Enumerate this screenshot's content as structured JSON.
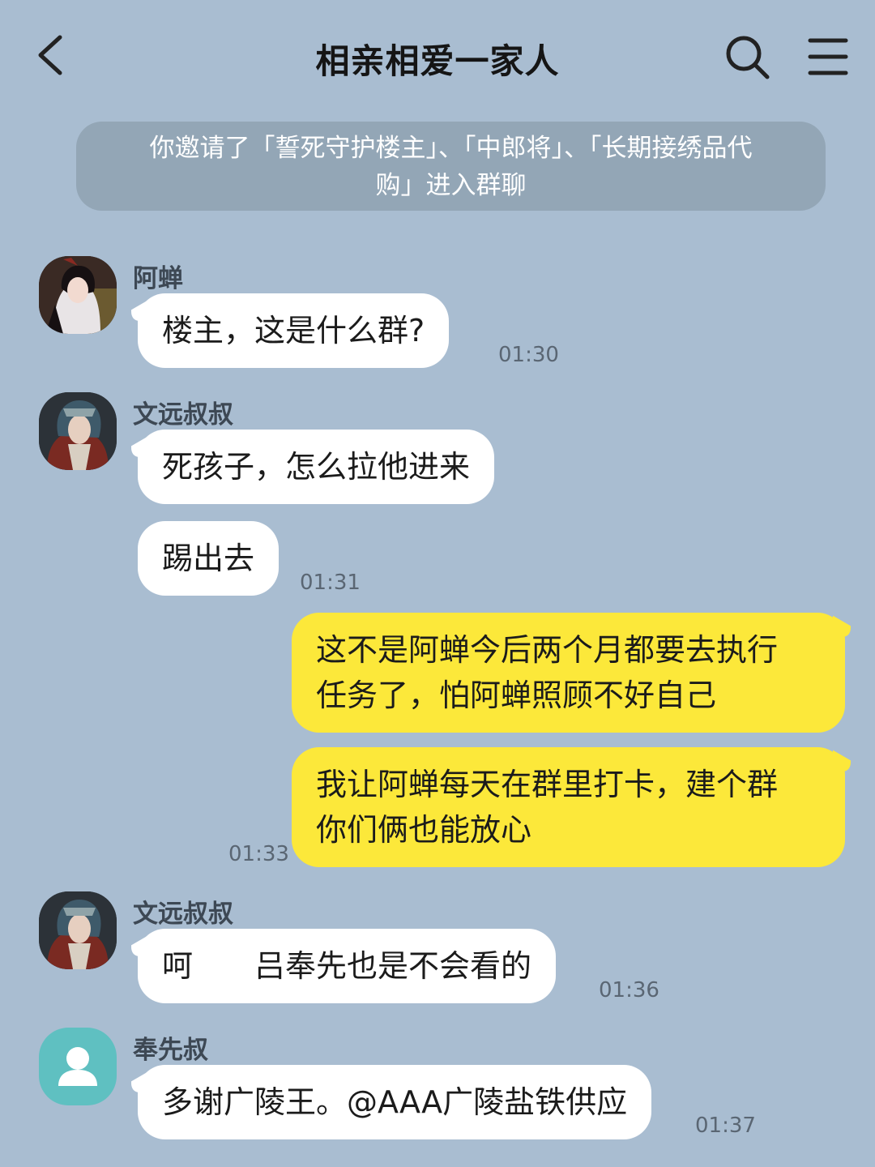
{
  "header": {
    "title": "相亲相爱一家人",
    "back_icon": "chevron-left-icon",
    "search_icon": "search-icon",
    "menu_icon": "menu-icon"
  },
  "system_notice": {
    "line1": "你邀请了「誓死守护楼主」、「中郎将」、「长期接绣品代",
    "line2": "购」进入群聊"
  },
  "messages": [
    {
      "sender": "阿蝉",
      "text": "楼主，这是什么群?",
      "time": "01:30"
    },
    {
      "sender": "文远叔叔",
      "text": "死孩子，怎么拉他进来"
    },
    {
      "text": "踢出去",
      "time": "01:31"
    },
    {
      "line1": "这不是阿蝉今后两个月都要去执行",
      "line2": "任务了，怕阿蝉照顾不好自己"
    },
    {
      "line1": "我让阿蝉每天在群里打卡，建个群",
      "line2": "你们俩也能放心",
      "time": "01:33"
    },
    {
      "sender": "文远叔叔",
      "text": "呵　　吕奉先也是不会看的",
      "time": "01:36"
    },
    {
      "sender": "奉先叔",
      "text": "多谢广陵王。@AAA广陵盐铁供应",
      "time": "01:37"
    }
  ],
  "colors": {
    "background": "#a9bdd1",
    "outgoing_bubble": "#fce83a",
    "incoming_bubble": "#ffffff",
    "system_notice": "#93a6b6",
    "default_avatar": "#5fc0c1"
  }
}
